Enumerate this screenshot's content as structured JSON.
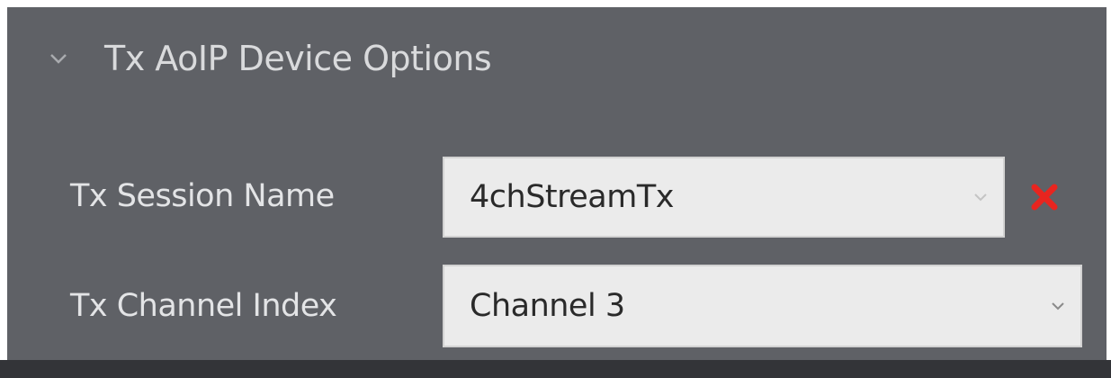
{
  "section": {
    "title": "Tx AoIP Device Options",
    "expanded": true,
    "chevron_icon": "chevron-down-icon"
  },
  "fields": {
    "session_name": {
      "label": "Tx Session Name",
      "value": "4chStreamTx",
      "dropdown_icon": "chevron-down-icon",
      "clear_icon": "close-icon",
      "clear_color": "#e8251f"
    },
    "channel_index": {
      "label": "Tx Channel Index",
      "value": "Channel 3",
      "dropdown_icon": "chevron-down-icon"
    }
  },
  "colors": {
    "panel_background": "#5f6166",
    "field_background": "#ebebeb",
    "label_text": "#e3e4e6",
    "accent_red": "#e8251f"
  }
}
